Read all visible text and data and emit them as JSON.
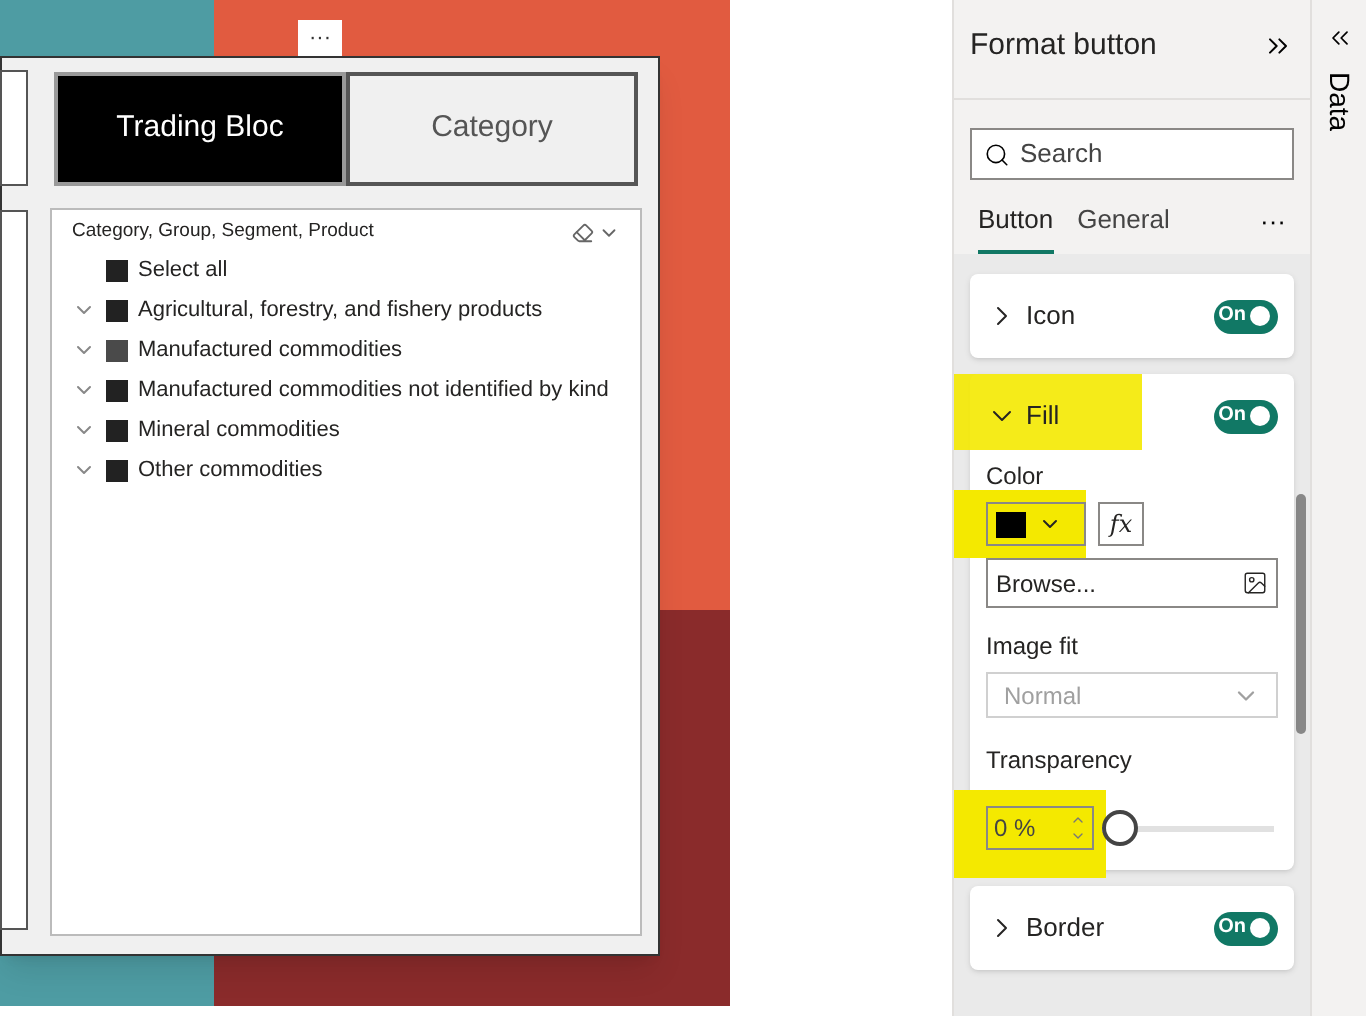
{
  "canvas": {
    "more_button": "···",
    "buttons": [
      {
        "label": "Trading Bloc",
        "selected": true
      },
      {
        "label": "Category",
        "selected": false
      }
    ],
    "slicer": {
      "title": "Category, Group, Segment, Product",
      "items": [
        {
          "label": "Select all",
          "expandable": false,
          "color": "#222222"
        },
        {
          "label": "Agricultural, forestry, and fishery products",
          "expandable": true,
          "color": "#222222"
        },
        {
          "label": "Manufactured commodities",
          "expandable": true,
          "color": "#4a4a4a"
        },
        {
          "label": "Manufactured commodities not identified by kind",
          "expandable": true,
          "color": "#222222"
        },
        {
          "label": "Mineral commodities",
          "expandable": true,
          "color": "#222222"
        },
        {
          "label": "Other commodities",
          "expandable": true,
          "color": "#222222"
        }
      ]
    }
  },
  "format_pane": {
    "title": "Format button",
    "search": {
      "placeholder": "Search"
    },
    "tabs": [
      {
        "label": "Button",
        "selected": true
      },
      {
        "label": "General",
        "selected": false
      }
    ],
    "more": "···",
    "sections": [
      {
        "label": "Icon",
        "expanded": false,
        "on": true,
        "toggle_label": "On"
      },
      {
        "label": "Fill",
        "expanded": true,
        "on": true,
        "toggle_label": "On",
        "highlighted": true
      },
      {
        "label": "Border",
        "expanded": false,
        "on": true,
        "toggle_label": "On"
      }
    ],
    "fill": {
      "color_label": "Color",
      "color": "#000000",
      "fx": "fx",
      "browse": "Browse...",
      "image_fit_label": "Image fit",
      "image_fit": {
        "value": "Normal",
        "disabled": true
      },
      "transparency_label": "Transparency",
      "transparency": {
        "value": "0 %",
        "level": 0
      }
    }
  },
  "data_pane": {
    "title": "Data"
  }
}
